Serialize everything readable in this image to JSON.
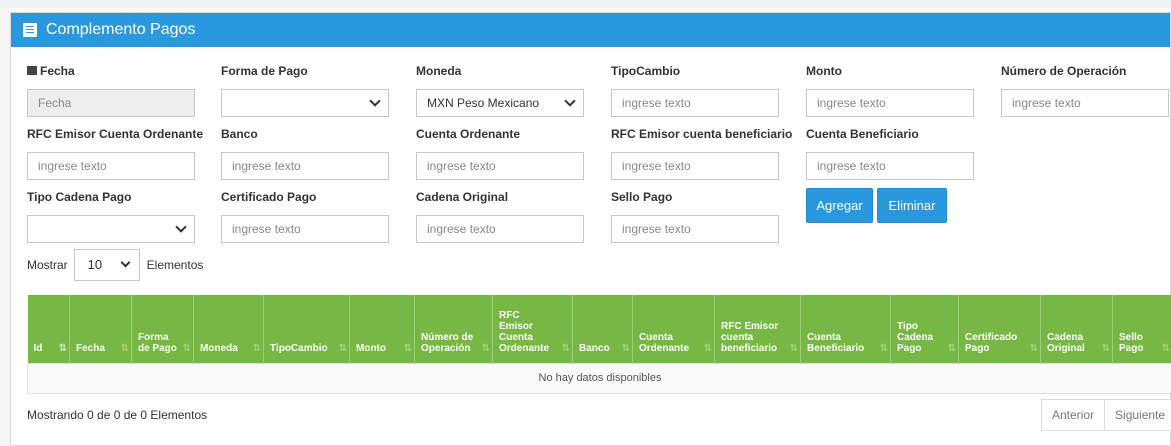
{
  "header": {
    "title": "Complemento Pagos",
    "icon": "list-alt-icon"
  },
  "colors": {
    "header": "#2a98de",
    "table_header": "#76b843",
    "button": "#2a98de"
  },
  "form": {
    "fecha": {
      "label": "Fecha",
      "placeholder": "Fecha"
    },
    "forma_pago": {
      "label": "Forma de Pago",
      "value": ""
    },
    "moneda": {
      "label": "Moneda",
      "value": "MXN Peso Mexicano"
    },
    "tipo_cambio": {
      "label": "TipoCambio",
      "placeholder": "ingrese texto"
    },
    "monto": {
      "label": "Monto",
      "placeholder": "ingrese texto"
    },
    "numero_operacion": {
      "label": "Número de Operación",
      "placeholder": "ingrese texto"
    },
    "rfc_emisor_ordenante": {
      "label": "RFC Emisor Cuenta Ordenante",
      "placeholder": "ingrese texto"
    },
    "banco": {
      "label": "Banco",
      "placeholder": "ingrese texto"
    },
    "cuenta_ordenante": {
      "label": "Cuenta Ordenante",
      "placeholder": "ingrese texto"
    },
    "rfc_emisor_beneficiario": {
      "label": "RFC Emisor cuenta beneficiario",
      "placeholder": "ingrese texto"
    },
    "cuenta_beneficiario": {
      "label": "Cuenta Beneficiario",
      "placeholder": "ingrese texto"
    },
    "tipo_cadena_pago": {
      "label": "Tipo Cadena Pago",
      "value": ""
    },
    "certificado_pago": {
      "label": "Certificado Pago",
      "placeholder": "ingrese texto"
    },
    "cadena_original": {
      "label": "Cadena Original",
      "placeholder": "ingrese texto"
    },
    "sello_pago": {
      "label": "Sello Pago",
      "placeholder": "ingrese texto"
    },
    "agregar_label": "Agregar",
    "eliminar_label": "Eliminar"
  },
  "table": {
    "show_label": "Mostrar",
    "page_length": "10",
    "elements_label": "Elementos",
    "columns": [
      "Id",
      "Fecha",
      "Forma de Pago",
      "Moneda",
      "TipoCambio",
      "Monto",
      "Número de Operación",
      "RFC Emisor Cuenta Ordenante",
      "Banco",
      "Cuenta Ordenante",
      "RFC Emisor cuenta beneficiario",
      "Cuenta Beneficiario",
      "Tipo Cadena Pago",
      "Certificado Pago",
      "Cadena Original",
      "Sello Pago"
    ],
    "empty_message": "No hay datos disponibles",
    "info": "Mostrando 0 de 0 de 0 Elementos",
    "prev_label": "Anterior",
    "next_label": "Siguiente"
  }
}
